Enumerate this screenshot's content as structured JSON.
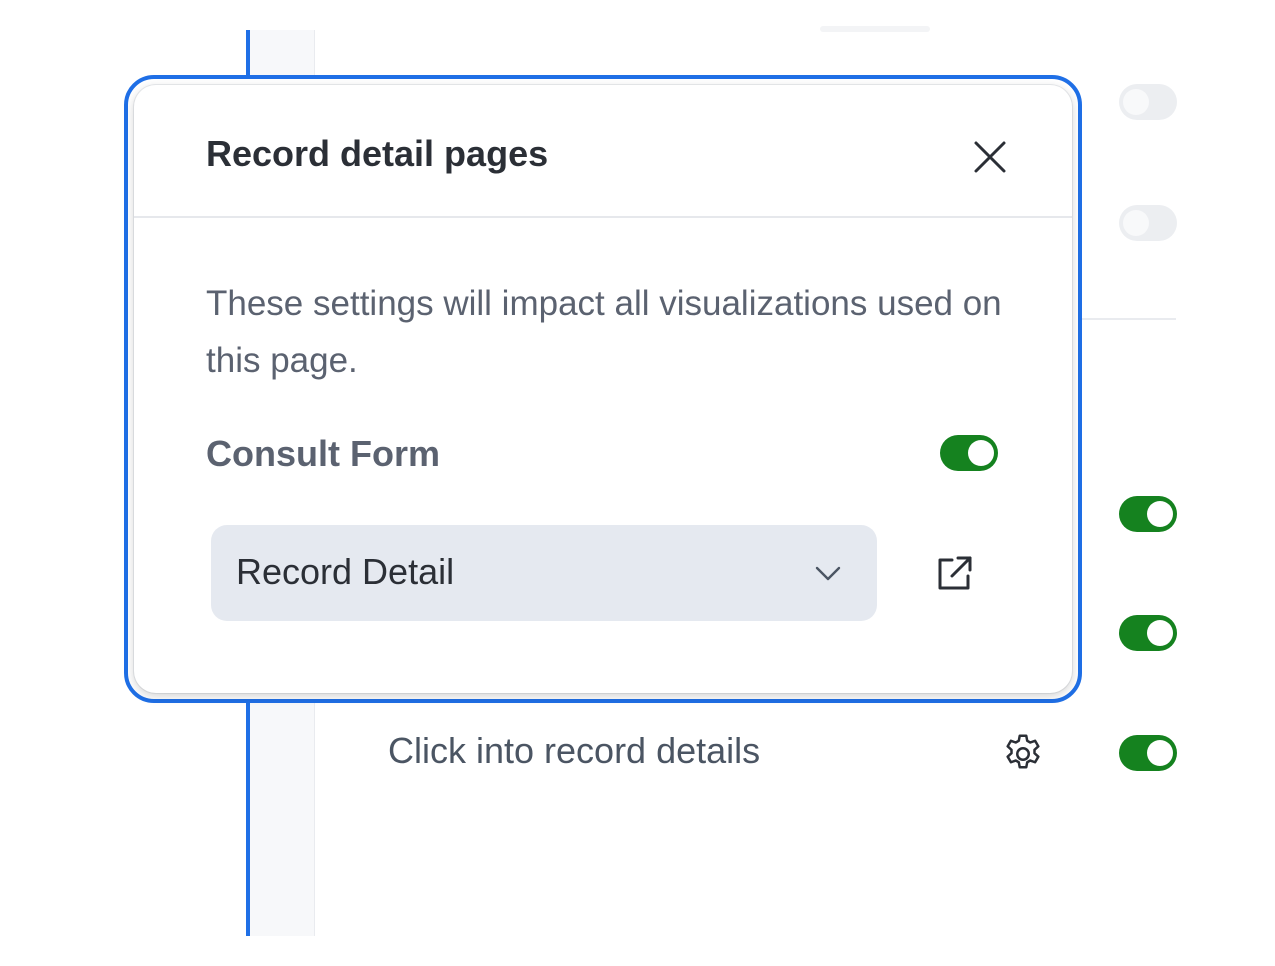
{
  "popover": {
    "title": "Record detail pages",
    "close_icon": "close-icon",
    "description": "These settings will impact all visualizations used on this page.",
    "consult_form": {
      "label": "Consult Form",
      "enabled": true
    },
    "page_select": {
      "value": "Record Detail",
      "chevron_icon": "chevron-down-icon"
    },
    "open_icon": "open-external-icon"
  },
  "background": {
    "row_label": "Click into record details",
    "gear_icon": "gear-icon",
    "toggles": [
      {
        "enabled": false
      },
      {
        "enabled": false
      },
      {
        "enabled": true
      },
      {
        "enabled": true
      },
      {
        "enabled": true
      }
    ]
  },
  "colors": {
    "accent_blue": "#1f6fe6",
    "toggle_on": "#15821f",
    "toggle_off": "#eceef1",
    "select_bg": "#e5e9f0",
    "title_text": "#2b2f36",
    "muted_text": "#5b6270"
  }
}
